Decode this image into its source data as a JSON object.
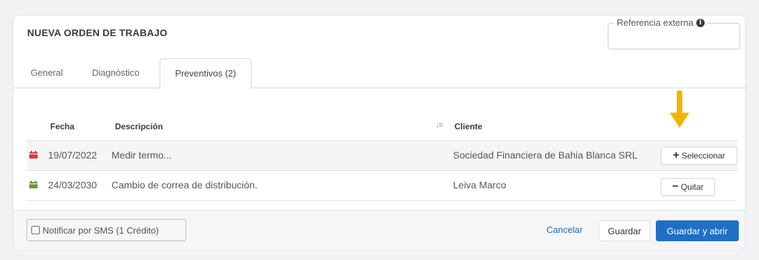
{
  "header": {
    "title": "NUEVA ORDEN DE TRABAJO",
    "external_reference": {
      "label": "Referencia externa",
      "value": ""
    }
  },
  "tabs": [
    {
      "label": "General",
      "active": false
    },
    {
      "label": "Diagnóstico",
      "active": false
    },
    {
      "label": "Preventivos (2)",
      "active": true
    }
  ],
  "table": {
    "columns": [
      "Fecha",
      "Descripción",
      "Cliente"
    ],
    "rows": [
      {
        "date": "19/07/2022",
        "description": "Medir termo...",
        "client": "Sociedad Financiera de Bahia Blanca SRL",
        "action": {
          "symbol": "+",
          "label": "Seleccionar"
        },
        "status_color": "#e8333a"
      },
      {
        "date": "24/03/2030",
        "description": "Cambio de correa de distribución.",
        "client": "Leiva Marco",
        "action": {
          "symbol": "−",
          "label": "Quitar"
        },
        "status_color": "#6a9a3a"
      }
    ]
  },
  "footer": {
    "sms_label": "Notificar por SMS (1 Crédito)",
    "sms_checked": false,
    "cancel_label": "Cancelar",
    "save_label": "Guardar",
    "save_open_label": "Guardar y abrir"
  },
  "colors": {
    "primary": "#1f6fc5",
    "link": "#2266b8",
    "annotation_arrow": "#f2b400"
  },
  "icons": {
    "info": "info-icon",
    "sort": "sort-icon",
    "calendar": "calendar-icon",
    "checkbox": "checkbox-icon",
    "annotation": "arrow-down-icon"
  }
}
